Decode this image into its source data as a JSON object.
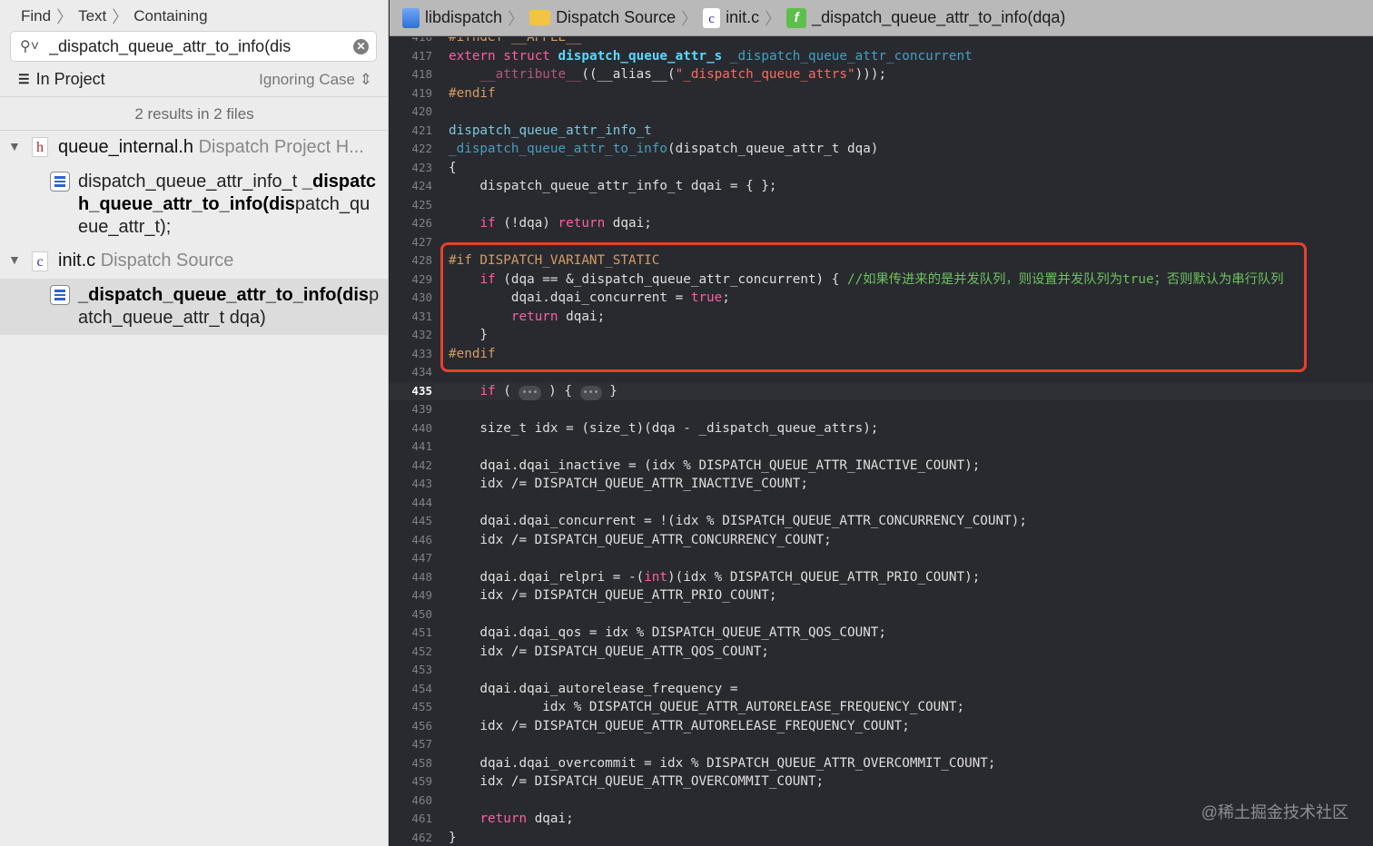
{
  "find_nav": {
    "items": [
      "Find",
      "Text",
      "Containing"
    ]
  },
  "search": {
    "value": "_dispatch_queue_attr_to_info(dis",
    "clear_icon": "✕"
  },
  "scope": {
    "label": "In Project",
    "case_label": "Ignoring Case"
  },
  "results_summary": "2 results in 2 files",
  "results": [
    {
      "file": "queue_internal.h",
      "group": "Dispatch Project H...",
      "icon_letter": "h",
      "icon_color": "#a3262e",
      "match": [
        {
          "text": "dispatch_queue_attr_info_t ",
          "bold": false
        },
        {
          "text": "_dispatch_queue_attr_to_info(dis",
          "bold": true
        },
        {
          "text": "patch_queue_attr_t);",
          "bold": false
        }
      ]
    },
    {
      "file": "init.c",
      "group": "Dispatch Source",
      "icon_letter": "c",
      "icon_color": "#3b2fa8",
      "match": [
        {
          "text": "_dispatch_queue_attr_to_info(dis",
          "bold": true
        },
        {
          "text": "patch_queue_attr_t dqa)",
          "bold": false
        }
      ]
    }
  ],
  "breadcrumb": {
    "project": "libdispatch",
    "group": "Dispatch Source",
    "file": "init.c",
    "file_letter": "c",
    "symbol_letter": "f",
    "symbol": "_dispatch_queue_attr_to_info(dqa)"
  },
  "current_line": 435,
  "code_lines": [
    {
      "n": 416,
      "t": [
        [
          "#ifndef __APPLE__",
          "pp"
        ]
      ]
    },
    {
      "n": 417,
      "t": [
        [
          "extern ",
          "kw"
        ],
        [
          "struct ",
          "kw"
        ],
        [
          "dispatch_queue_attr_s",
          "typeb"
        ],
        [
          " ",
          ""
        ],
        [
          "_dispatch_queue_attr_concurrent",
          "gl"
        ]
      ]
    },
    {
      "n": 418,
      "t": [
        [
          "    ",
          ""
        ],
        [
          "__attribute__",
          "kw2"
        ],
        [
          "((__alias__(",
          ""
        ],
        [
          "\"_dispatch_queue_attrs\"",
          "str"
        ],
        [
          ")));",
          ""
        ]
      ]
    },
    {
      "n": 419,
      "t": [
        [
          "#endif",
          "pp"
        ]
      ]
    },
    {
      "n": 420,
      "t": []
    },
    {
      "n": 421,
      "t": [
        [
          "dispatch_queue_attr_info_t",
          "ty"
        ]
      ]
    },
    {
      "n": 422,
      "t": [
        [
          "_dispatch_queue_attr_to_info",
          "gl"
        ],
        [
          "(dispatch_queue_attr_t dqa)",
          ""
        ]
      ]
    },
    {
      "n": 423,
      "t": [
        [
          "{",
          ""
        ]
      ]
    },
    {
      "n": 424,
      "t": [
        [
          "    dispatch_queue_attr_info_t dqai = { };",
          ""
        ]
      ]
    },
    {
      "n": 425,
      "t": []
    },
    {
      "n": 426,
      "t": [
        [
          "    ",
          ""
        ],
        [
          "if",
          "kw"
        ],
        [
          " (!dqa) ",
          ""
        ],
        [
          "return",
          "kw"
        ],
        [
          " dqai;",
          ""
        ]
      ]
    },
    {
      "n": 427,
      "t": []
    },
    {
      "n": 428,
      "t": [
        [
          "#if DISPATCH_VARIANT_STATIC",
          "pp"
        ]
      ]
    },
    {
      "n": 429,
      "t": [
        [
          "    ",
          ""
        ],
        [
          "if",
          "kw"
        ],
        [
          " (dqa == &_dispatch_queue_attr_concurrent) { ",
          ""
        ],
        [
          "//如果传进来的是并发队列，则设置并发队列为true；否则默认为串行队列",
          "cm"
        ]
      ]
    },
    {
      "n": 430,
      "t": [
        [
          "        dqai.dqai_concurrent = ",
          ""
        ],
        [
          "true",
          "kw"
        ],
        [
          ";",
          ""
        ]
      ]
    },
    {
      "n": 431,
      "t": [
        [
          "        ",
          ""
        ],
        [
          "return",
          "kw"
        ],
        [
          " dqai;",
          ""
        ]
      ]
    },
    {
      "n": 432,
      "t": [
        [
          "    }",
          ""
        ]
      ]
    },
    {
      "n": 433,
      "t": [
        [
          "#endif",
          "pp"
        ]
      ]
    },
    {
      "n": 434,
      "t": []
    },
    {
      "n": 435,
      "t": [
        [
          "    ",
          ""
        ],
        [
          "if",
          "kw"
        ],
        [
          " ( ",
          ""
        ],
        [
          "•••",
          "fold"
        ],
        [
          " ) { ",
          ""
        ],
        [
          "•••",
          "fold"
        ],
        [
          " }",
          ""
        ]
      ]
    },
    {
      "n": 439,
      "t": []
    },
    {
      "n": 440,
      "t": [
        [
          "    size_t idx = (size_t)(dqa - _dispatch_queue_attrs);",
          ""
        ]
      ]
    },
    {
      "n": 441,
      "t": []
    },
    {
      "n": 442,
      "t": [
        [
          "    dqai.dqai_inactive = (idx % DISPATCH_QUEUE_ATTR_INACTIVE_COUNT);",
          ""
        ]
      ]
    },
    {
      "n": 443,
      "t": [
        [
          "    idx /= DISPATCH_QUEUE_ATTR_INACTIVE_COUNT;",
          ""
        ]
      ]
    },
    {
      "n": 444,
      "t": []
    },
    {
      "n": 445,
      "t": [
        [
          "    dqai.dqai_concurrent = !(idx % DISPATCH_QUEUE_ATTR_CONCURRENCY_COUNT);",
          ""
        ]
      ]
    },
    {
      "n": 446,
      "t": [
        [
          "    idx /= DISPATCH_QUEUE_ATTR_CONCURRENCY_COUNT;",
          ""
        ]
      ]
    },
    {
      "n": 447,
      "t": []
    },
    {
      "n": 448,
      "t": [
        [
          "    dqai.dqai_relpri = -(",
          ""
        ],
        [
          "int",
          "kw"
        ],
        [
          ")(idx % DISPATCH_QUEUE_ATTR_PRIO_COUNT);",
          ""
        ]
      ]
    },
    {
      "n": 449,
      "t": [
        [
          "    idx /= DISPATCH_QUEUE_ATTR_PRIO_COUNT;",
          ""
        ]
      ]
    },
    {
      "n": 450,
      "t": []
    },
    {
      "n": 451,
      "t": [
        [
          "    dqai.dqai_qos = idx % DISPATCH_QUEUE_ATTR_QOS_COUNT;",
          ""
        ]
      ]
    },
    {
      "n": 452,
      "t": [
        [
          "    idx /= DISPATCH_QUEUE_ATTR_QOS_COUNT;",
          ""
        ]
      ]
    },
    {
      "n": 453,
      "t": []
    },
    {
      "n": 454,
      "t": [
        [
          "    dqai.dqai_autorelease_frequency =",
          ""
        ]
      ]
    },
    {
      "n": 455,
      "t": [
        [
          "            idx % DISPATCH_QUEUE_ATTR_AUTORELEASE_FREQUENCY_COUNT;",
          ""
        ]
      ]
    },
    {
      "n": 456,
      "t": [
        [
          "    idx /= DISPATCH_QUEUE_ATTR_AUTORELEASE_FREQUENCY_COUNT;",
          ""
        ]
      ]
    },
    {
      "n": 457,
      "t": []
    },
    {
      "n": 458,
      "t": [
        [
          "    dqai.dqai_overcommit = idx % DISPATCH_QUEUE_ATTR_OVERCOMMIT_COUNT;",
          ""
        ]
      ]
    },
    {
      "n": 459,
      "t": [
        [
          "    idx /= DISPATCH_QUEUE_ATTR_OVERCOMMIT_COUNT;",
          ""
        ]
      ]
    },
    {
      "n": 460,
      "t": []
    },
    {
      "n": 461,
      "t": [
        [
          "    ",
          ""
        ],
        [
          "return",
          "kw"
        ],
        [
          " dqai;",
          ""
        ]
      ]
    },
    {
      "n": 462,
      "t": [
        [
          "}",
          ""
        ]
      ]
    }
  ],
  "highlight_color": "#e8402d",
  "watermark": "@稀土掘金技术社区"
}
